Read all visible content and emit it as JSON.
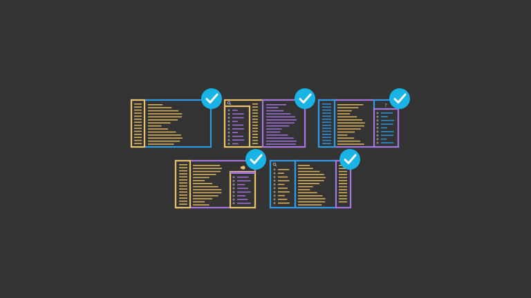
{
  "colors": {
    "background": "#333333",
    "panel_fill": "#333333",
    "yellow": "#E8C36A",
    "blue": "#2E9BE6",
    "purple": "#A675E0",
    "line_yellow": "#D9B25C",
    "line_blue": "#2A90D8",
    "line_purple": "#9E6FD8",
    "check_fill": "#19B3E6",
    "check_mark": "#FFFFFF",
    "icon_gray": "#B9B9B9"
  },
  "layouts": [
    {
      "id": "layout-1",
      "checked": true
    },
    {
      "id": "layout-2",
      "checked": true,
      "search_icon": "search-icon"
    },
    {
      "id": "layout-3",
      "checked": true,
      "help_icon": "question-icon",
      "help_text": "?"
    },
    {
      "id": "layout-4",
      "checked": true,
      "marker_icon": "yellow-dot-icon"
    },
    {
      "id": "layout-5",
      "checked": true,
      "search_icon": "search-icon"
    }
  ]
}
